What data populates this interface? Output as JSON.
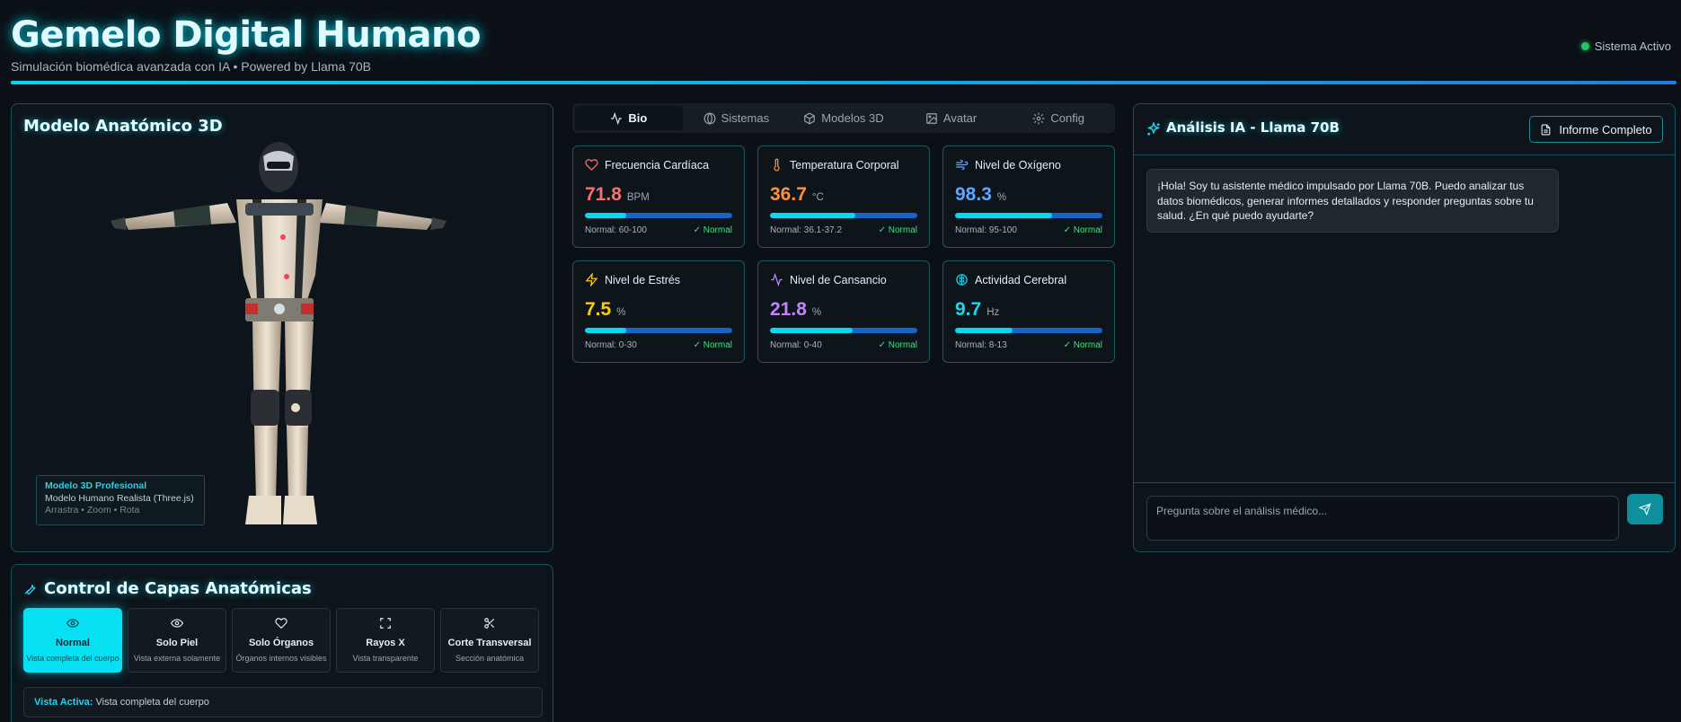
{
  "header": {
    "title": "Gemelo Digital Humano",
    "subtitle": "Simulación biomédica avanzada con IA • Powered by Llama 70B",
    "status": "Sistema Activo"
  },
  "model": {
    "title": "Modelo Anatómico 3D",
    "info_title": "Modelo 3D Profesional",
    "info_name": "Modelo Humano Realista (Three.js)",
    "info_hint": "Arrastra • Zoom • Rota"
  },
  "layers": {
    "title": "Control de Capas Anatómicas",
    "buttons": [
      {
        "label": "Normal",
        "desc": "Vista completa del cuerpo",
        "icon": "eye-icon"
      },
      {
        "label": "Solo Piel",
        "desc": "Vista externa solamente",
        "icon": "eye-icon"
      },
      {
        "label": "Solo Órganos",
        "desc": "Órganos internos visibles",
        "icon": "heart-icon"
      },
      {
        "label": "Rayos X",
        "desc": "Vista transparente",
        "icon": "scan-icon"
      },
      {
        "label": "Corte Transversal",
        "desc": "Sección anatómica",
        "icon": "scissors-icon"
      }
    ],
    "active_label": "Vista Activa:",
    "active_value": "Vista completa del cuerpo"
  },
  "tabs": [
    {
      "label": "Bio",
      "icon": "activity-icon"
    },
    {
      "label": "Sistemas",
      "icon": "globe-icon"
    },
    {
      "label": "Modelos 3D",
      "icon": "cube-icon"
    },
    {
      "label": "Avatar",
      "icon": "image-icon"
    },
    {
      "label": "Config",
      "icon": "gear-icon"
    }
  ],
  "vitals": [
    {
      "name": "Frecuencia Cardíaca",
      "value": "71.8",
      "unit": "BPM",
      "range": "Normal: 60-100",
      "status": "✓ Normal",
      "level": 0.28,
      "color": "#f87171",
      "icon": "heart-icon"
    },
    {
      "name": "Temperatura Corporal",
      "value": "36.7",
      "unit": "°C",
      "range": "Normal: 36.1-37.2",
      "status": "✓ Normal",
      "level": 0.58,
      "color": "#fb923c",
      "icon": "thermometer-icon"
    },
    {
      "name": "Nivel de Oxígeno",
      "value": "98.3",
      "unit": "%",
      "range": "Normal: 95-100",
      "status": "✓ Normal",
      "level": 0.66,
      "color": "#60a5fa",
      "icon": "wind-icon"
    },
    {
      "name": "Nivel de Estrés",
      "value": "7.5",
      "unit": "%",
      "range": "Normal: 0-30",
      "status": "✓ Normal",
      "level": 0.28,
      "color": "#facc15",
      "icon": "zap-icon"
    },
    {
      "name": "Nivel de Cansancio",
      "value": "21.8",
      "unit": "%",
      "range": "Normal: 0-40",
      "status": "✓ Normal",
      "level": 0.56,
      "color": "#c084fc",
      "icon": "activity-icon"
    },
    {
      "name": "Actividad Cerebral",
      "value": "9.7",
      "unit": "Hz",
      "range": "Normal: 8-13",
      "status": "✓ Normal",
      "level": 0.39,
      "color": "#22d3ee",
      "icon": "brain-icon"
    }
  ],
  "ai": {
    "title": "Análisis IA - Llama 70B",
    "report_button": "Informe Completo",
    "message": "¡Hola! Soy tu asistente médico impulsado por Llama 70B. Puedo analizar tus datos biomédicos, generar informes detallados y responder preguntas sobre tu salud. ¿En qué puedo ayudarte?",
    "input_placeholder": "Pregunta sobre el análisis médico..."
  }
}
